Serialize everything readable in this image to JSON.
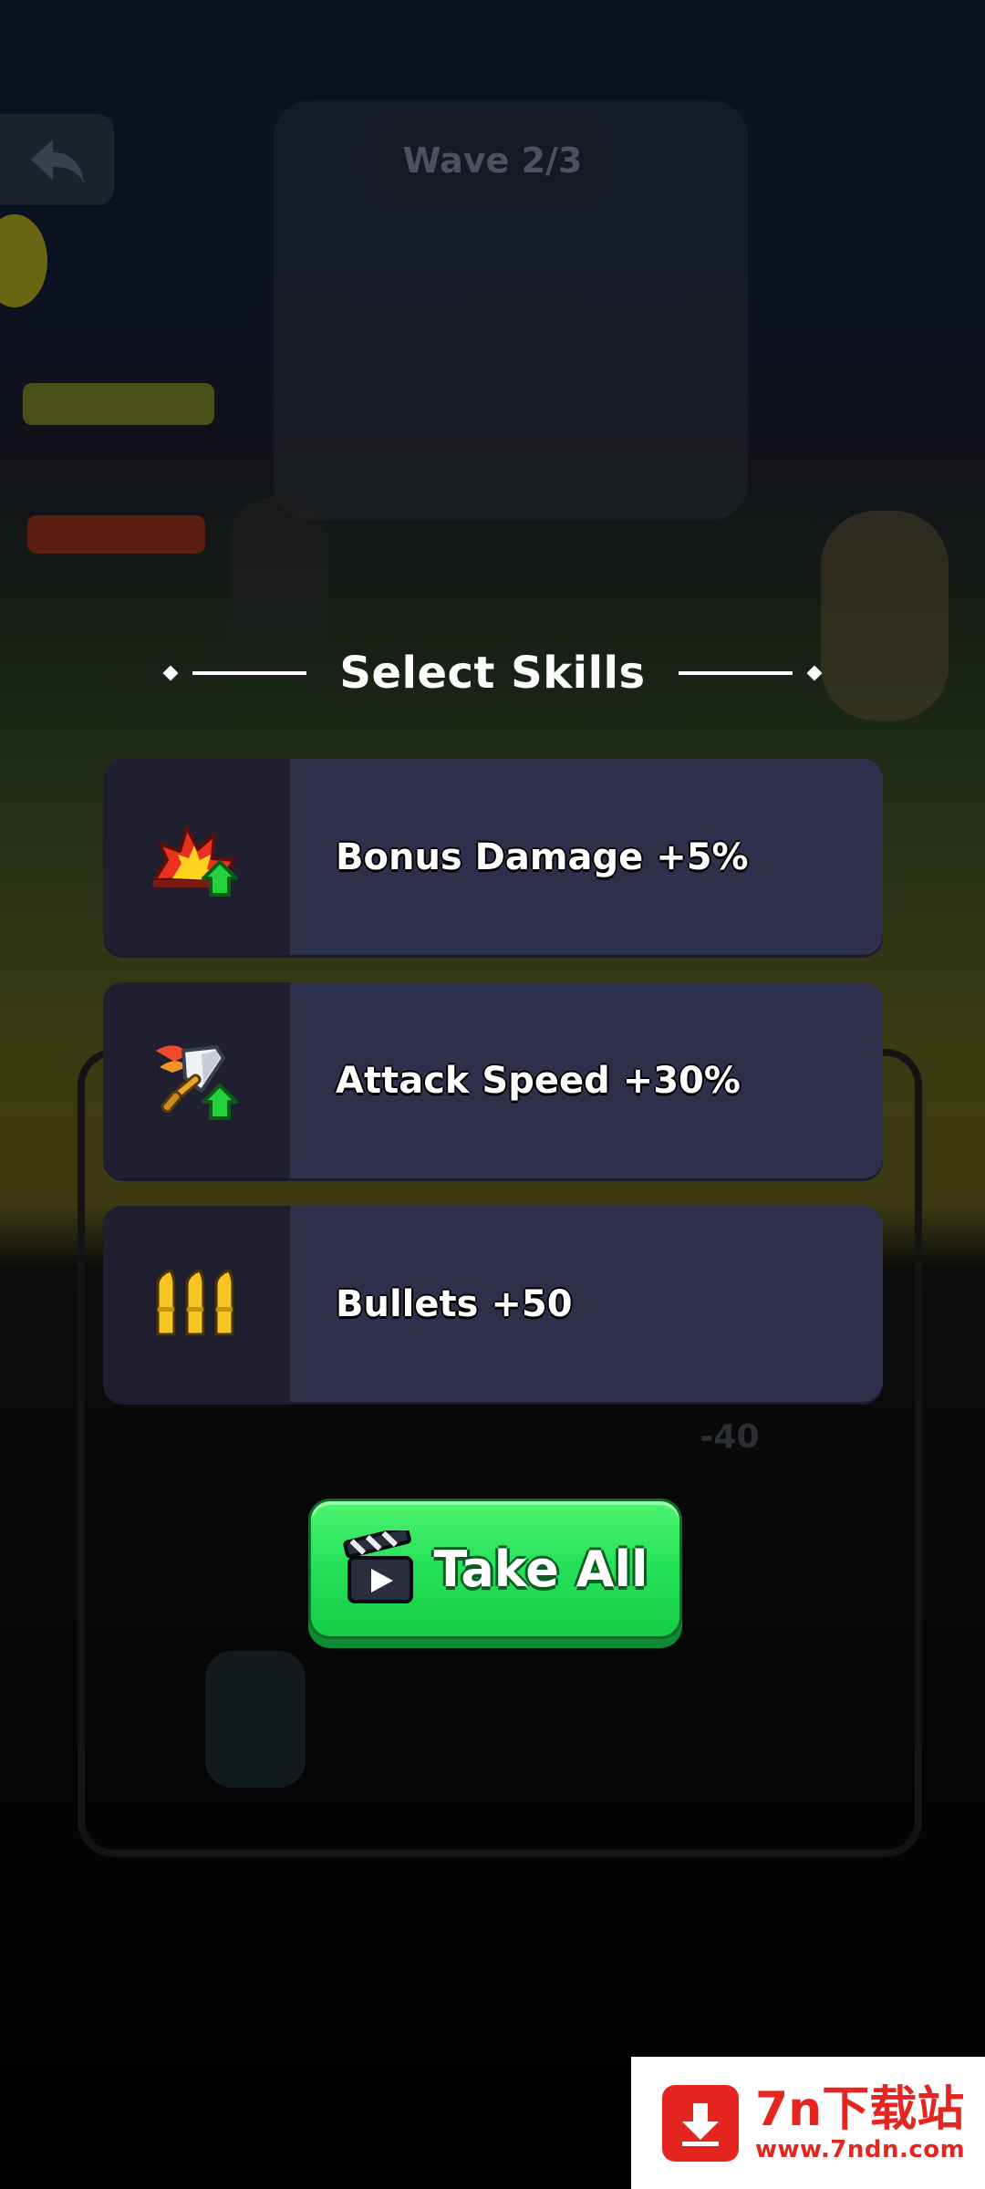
{
  "background": {
    "wave_label": "Wave 2/3",
    "tag_value": "-40"
  },
  "dialog": {
    "title": "Select Skills",
    "skills": [
      {
        "icon": "explosion-up-icon",
        "label": "Bonus Damage +5%"
      },
      {
        "icon": "sword-up-icon",
        "label": "Attack Speed +30%"
      },
      {
        "icon": "bullets-icon",
        "label": "Bullets +50"
      }
    ],
    "take_all": {
      "icon": "clapperboard-video-icon",
      "label": "Take All"
    }
  },
  "watermark": {
    "title": "7n下载站",
    "url": "www.7ndn.com"
  },
  "colors": {
    "card_bg": "#2e2f4a",
    "icon_box_bg": "#1f1f30",
    "button_green": "#27e35a",
    "watermark_red": "#e52620"
  }
}
